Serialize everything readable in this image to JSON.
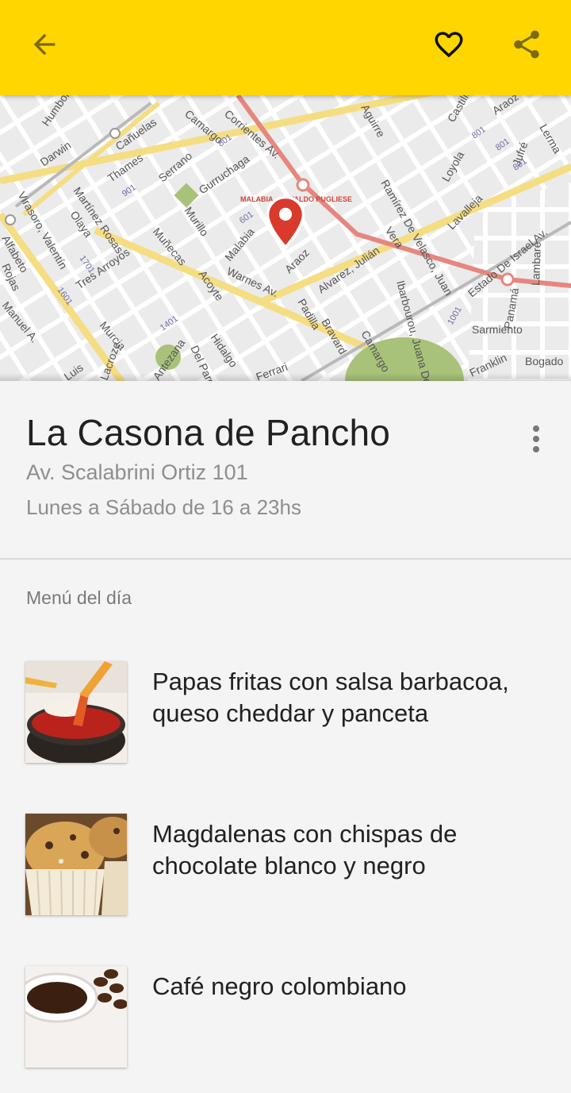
{
  "toolbar": {
    "back_icon": "arrow-back-icon",
    "favorite_icon": "heart-outline-icon",
    "share_icon": "share-icon",
    "color": "#FFD600"
  },
  "map": {
    "streets": [
      "Humboldt",
      "Darwin",
      "Cañuelas",
      "Camargo",
      "Corrientes Av.",
      "Aguirre",
      "Castillo",
      "Aráoz",
      "Lerma",
      "Virasoro, Valentín",
      "Thames",
      "Serrano",
      "Gurruchaga",
      "Loyola",
      "Jufré",
      "Martínez Rosas",
      "Oláya",
      "Murillo",
      "Malabia",
      "Ramírez De Velasco, Juan",
      "Lavalleja",
      "Estado De Israel Av.",
      "Alfabeto",
      "Rojas",
      "Muñecas",
      "Warnes Av.",
      "Araoz",
      "Vera",
      "Lambaré",
      "Tres Arroyos",
      "Acoyte",
      "Alvarez, Julián",
      "Panamá",
      "Manuel A.",
      "Murcia",
      "Hidalgo",
      "Padilla",
      "Bravard",
      "Camargo",
      "Ibarbourou, Juana De",
      "Sarmiento",
      "Franklin",
      "Bogado",
      "Luis",
      "Del Parque",
      "Antezana",
      "Ferrari",
      "Lacroze"
    ],
    "station_label": "MALABIA - OSVALDO PUGLIESE",
    "numbers": [
      "801",
      "901",
      "1601",
      "1701",
      "1401",
      "1001",
      "601"
    ],
    "pin_color": "#d93a2b"
  },
  "place": {
    "name": "La Casona de Pancho",
    "address": "Av. Scalabrini Ortiz 101",
    "hours": "Lunes a Sábado de 16 a 23hs"
  },
  "menu": {
    "label": "Menú del día",
    "items": [
      {
        "name": "Papas fritas con salsa barbacoa, queso cheddar y panceta",
        "image": "fries-with-sauce"
      },
      {
        "name": "Magdalenas con chispas de chocolate blanco y negro",
        "image": "chocolate-chip-muffins"
      },
      {
        "name": "Café negro colombiano",
        "image": "black-coffee-cup"
      }
    ]
  }
}
